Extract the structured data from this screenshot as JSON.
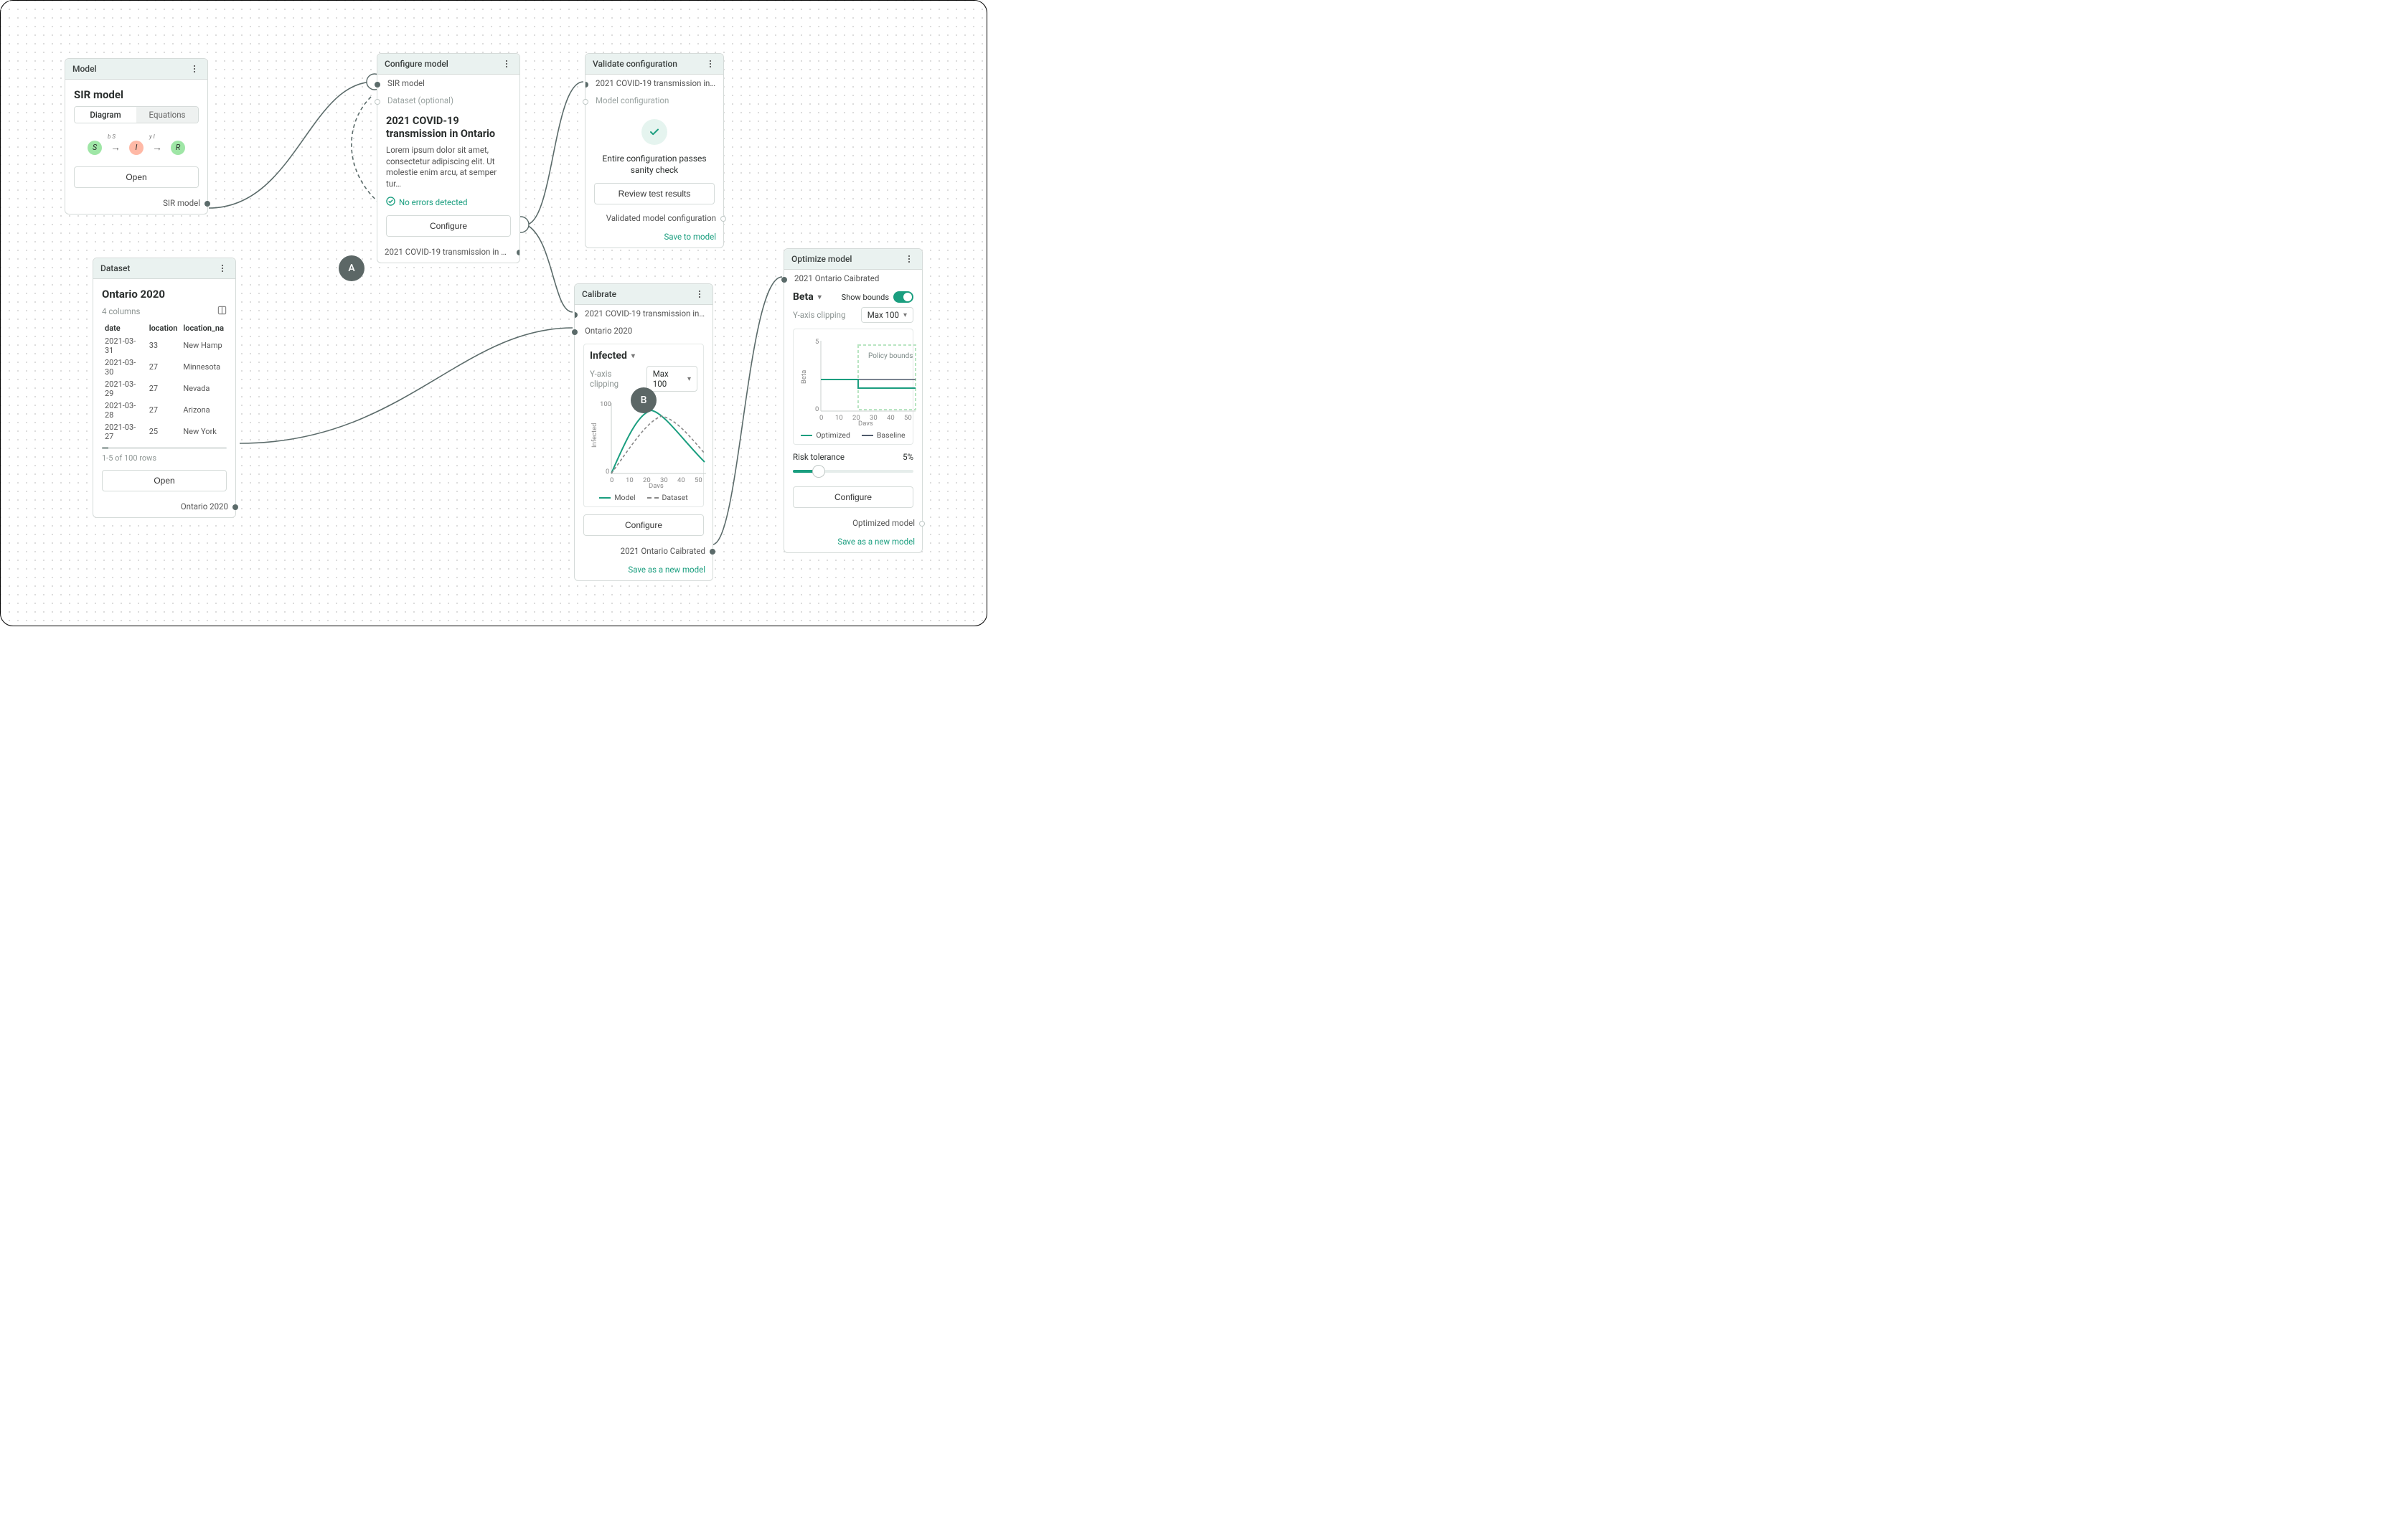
{
  "model": {
    "header": "Model",
    "title": "SIR model",
    "tabs": {
      "diagram": "Diagram",
      "equations": "Equations"
    },
    "sir": {
      "s": "S",
      "i": "I",
      "r": "R",
      "bs": "b S",
      "yi": "y I"
    },
    "open": "Open",
    "output_label": "SIR model"
  },
  "configure": {
    "header": "Configure model",
    "in_model": "SIR model",
    "in_dataset": "Dataset (optional)",
    "cfg_title": "2021 COVID-19 transmission in Ontario",
    "cfg_desc": "Lorem ipsum dolor sit amet, consectetur adipiscing elit. Ut molestie enim arcu, at semper tur…",
    "no_errors": "No errors detected",
    "btn": "Configure",
    "output_label": "2021 COVID-19 transmission in On…"
  },
  "validate": {
    "header": "Validate configuration",
    "in_cfg": "2021 COVID-19 transmission in Onta…",
    "in_model_cfg": "Model configuration",
    "pass_msg": "Entire configuration passes sanity check",
    "review": "Review test results",
    "output_label": "Validated model configuration",
    "save": "Save to model"
  },
  "dataset": {
    "header": "Dataset",
    "title": "Ontario 2020",
    "cols": "4 columns",
    "headers": [
      "date",
      "location",
      "location_na"
    ],
    "rows": [
      [
        "2021-03-31",
        "33",
        "New Hamp"
      ],
      [
        "2021-03-30",
        "27",
        "Minnesota"
      ],
      [
        "2021-03-29",
        "27",
        "Nevada"
      ],
      [
        "2021-03-28",
        "27",
        "Arizona"
      ],
      [
        "2021-03-27",
        "25",
        "New York"
      ]
    ],
    "row_note": "1-5 of 100 rows",
    "open": "Open",
    "output_label": "Ontario 2020"
  },
  "calibrate": {
    "header": "Calibrate",
    "in_cfg": "2021 COVID-19 transmission in Onta…",
    "in_dataset": "Ontario 2020",
    "variable": "Infected",
    "yclip_label": "Y-axis clipping",
    "yclip_value": "Max 100",
    "legend_model": "Model",
    "legend_dataset": "Dataset",
    "btn": "Configure",
    "output_label": "2021 Ontario Caibrated",
    "save": "Save as a new model",
    "xlabel": "Days",
    "ylabel": "Infected"
  },
  "optimize": {
    "header": "Optimize model",
    "in_label": "2021 Ontario Caibrated",
    "variable": "Beta",
    "show_bounds": "Show bounds",
    "yclip_label": "Y-axis clipping",
    "yclip_value": "Max 100",
    "policy": "Policy bounds",
    "legend_opt": "Optimized",
    "legend_base": "Baseline",
    "risk_label": "Risk tolerance",
    "risk_value": "5%",
    "btn": "Configure",
    "output_label": "Optimized model",
    "save": "Save as a new model",
    "xlabel": "Days",
    "ylabel": "Beta",
    "ytick": "5"
  },
  "badges": {
    "a": "A",
    "b": "B"
  },
  "chart_data": [
    {
      "type": "line",
      "title": "Infected",
      "xlabel": "Days",
      "ylabel": "Infected",
      "xlim": [
        0,
        50
      ],
      "ylim": [
        0,
        100
      ],
      "x": [
        0,
        10,
        20,
        30,
        40,
        50
      ],
      "series": [
        {
          "name": "Model",
          "values": [
            0,
            55,
            88,
            70,
            42,
            20
          ]
        },
        {
          "name": "Dataset",
          "values": [
            0,
            40,
            78,
            82,
            60,
            30
          ]
        }
      ]
    },
    {
      "type": "line",
      "title": "Beta",
      "xlabel": "Days",
      "ylabel": "Beta",
      "xlim": [
        0,
        50
      ],
      "ylim": [
        0,
        5
      ],
      "x": [
        0,
        10,
        20,
        30,
        40,
        50
      ],
      "series": [
        {
          "name": "Optimized",
          "values": [
            2.0,
            2.0,
            2.0,
            1.5,
            1.5,
            1.5
          ]
        },
        {
          "name": "Baseline",
          "values": [
            2.0,
            2.0,
            2.0,
            2.0,
            2.0,
            2.0
          ]
        }
      ],
      "annotations": [
        {
          "label": "Policy bounds",
          "x0": 20,
          "x1": 50,
          "y0": 0.5,
          "y1": 4.8
        }
      ]
    }
  ]
}
